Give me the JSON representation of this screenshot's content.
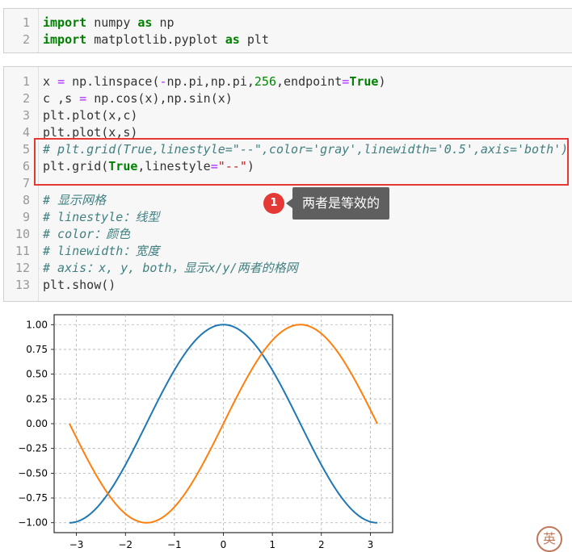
{
  "cell1": {
    "lines": [
      {
        "n": "1",
        "segments": [
          [
            "kw",
            "import"
          ],
          [
            "txt",
            " numpy "
          ],
          [
            "kw",
            "as"
          ],
          [
            "txt",
            " np"
          ]
        ]
      },
      {
        "n": "2",
        "segments": [
          [
            "kw",
            "import"
          ],
          [
            "txt",
            " matplotlib.pyplot "
          ],
          [
            "kw",
            "as"
          ],
          [
            "txt",
            " plt"
          ]
        ]
      }
    ]
  },
  "cell2": {
    "lines": [
      {
        "n": "1",
        "segments": [
          [
            "txt",
            "x "
          ],
          [
            "op",
            "="
          ],
          [
            "txt",
            " np.linspace("
          ],
          [
            "op",
            "-"
          ],
          [
            "txt",
            "np.pi,np.pi,"
          ],
          [
            "num",
            "256"
          ],
          [
            "txt",
            ",endpoint"
          ],
          [
            "op",
            "="
          ],
          [
            "kw",
            "True"
          ],
          [
            "txt",
            ")"
          ]
        ]
      },
      {
        "n": "2",
        "segments": [
          [
            "txt",
            "c ,s "
          ],
          [
            "op",
            "="
          ],
          [
            "txt",
            " np.cos(x),np.sin(x)"
          ]
        ]
      },
      {
        "n": "3",
        "segments": [
          [
            "txt",
            "plt.plot(x,c)"
          ]
        ]
      },
      {
        "n": "4",
        "segments": [
          [
            "txt",
            "plt.plot(x,s)"
          ]
        ]
      },
      {
        "n": "5",
        "segments": [
          [
            "cm",
            "# plt.grid(True,linestyle=\"--\",color='gray',linewidth='0.5',axis='both')"
          ]
        ]
      },
      {
        "n": "6",
        "segments": [
          [
            "txt",
            "plt.grid("
          ],
          [
            "kw",
            "True"
          ],
          [
            "txt",
            ",linestyle"
          ],
          [
            "op",
            "="
          ],
          [
            "str",
            "\"--\""
          ],
          [
            "txt",
            ")"
          ]
        ]
      },
      {
        "n": "7",
        "segments": []
      },
      {
        "n": "8",
        "segments": [
          [
            "cm",
            "# 显示网格"
          ]
        ]
      },
      {
        "n": "9",
        "segments": [
          [
            "cm",
            "# linestyle：线型"
          ]
        ]
      },
      {
        "n": "10",
        "segments": [
          [
            "cm",
            "# color：颜色"
          ]
        ]
      },
      {
        "n": "11",
        "segments": [
          [
            "cm",
            "# linewidth：宽度"
          ]
        ]
      },
      {
        "n": "12",
        "segments": [
          [
            "cm",
            "# axis：x, y, both，显示x/y/两者的格网"
          ]
        ]
      },
      {
        "n": "13",
        "segments": [
          [
            "txt",
            "plt.show()"
          ]
        ]
      }
    ]
  },
  "annotation": {
    "badge": "1",
    "tooltip": "两者是等效的"
  },
  "watermark": "英",
  "colors": {
    "highlight": "#e53935",
    "cos_line": "#1f77b4",
    "sin_line": "#ff7f0e"
  },
  "chart_data": {
    "type": "line",
    "functions": [
      "cos",
      "sin"
    ],
    "x_range": [
      -3.14159,
      3.14159
    ],
    "n_points": 256,
    "series": [
      {
        "color": "#1f77b4"
      },
      {
        "color": "#ff7f0e"
      }
    ],
    "xticks": [
      "−3",
      "−2",
      "−1",
      "0",
      "1",
      "2",
      "3"
    ],
    "xtick_values": [
      -3,
      -2,
      -1,
      0,
      1,
      2,
      3
    ],
    "yticks": [
      "1.00",
      "0.75",
      "0.50",
      "0.25",
      "0.00",
      "−0.25",
      "−0.50",
      "−0.75",
      "−1.00"
    ],
    "ytick_values": [
      1,
      0.75,
      0.5,
      0.25,
      0,
      -0.25,
      -0.5,
      -0.75,
      -1
    ],
    "xlim": [
      -3.455,
      3.455
    ],
    "ylim": [
      -1.1,
      1.1
    ],
    "grid": true,
    "grid_linestyle": "dashed"
  }
}
